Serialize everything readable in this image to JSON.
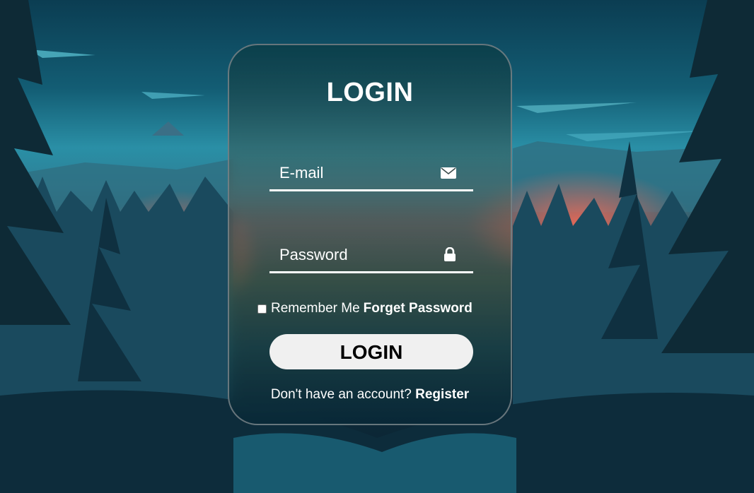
{
  "login_form": {
    "title": "LOGIN",
    "email": {
      "placeholder": "E-mail",
      "icon": "envelope-icon"
    },
    "password": {
      "placeholder": "Password",
      "icon": "lock-icon"
    },
    "remember_label": "Remember Me",
    "forget_link": "Forget Password",
    "submit_label": "LOGIN",
    "register_prompt": "Don't have an account?",
    "register_link": "Register"
  },
  "colors": {
    "card_border": "#7a8287",
    "button_bg": "#f0f0f0",
    "text": "#ffffff"
  }
}
